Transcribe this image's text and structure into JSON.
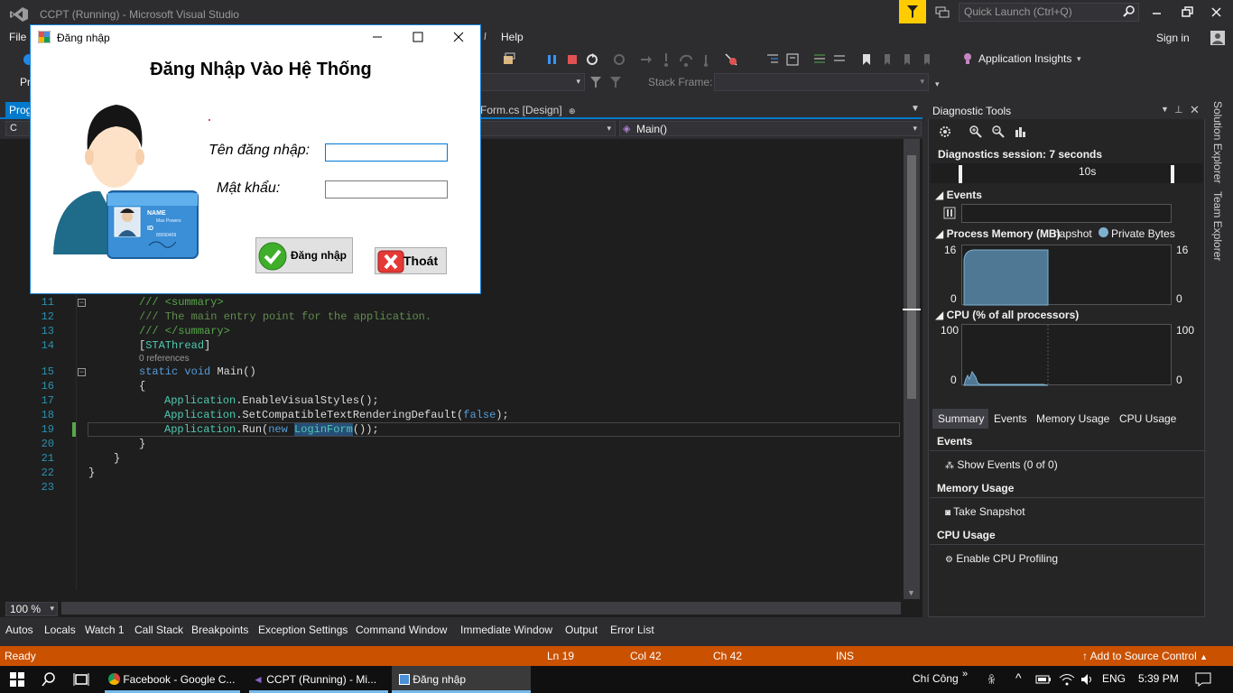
{
  "window": {
    "title": "CCPT (Running) - Microsoft Visual Studio",
    "quick_launch_placeholder": "Quick Launch (Ctrl+Q)",
    "sign_in": "Sign in"
  },
  "menu": [
    "File",
    "Help"
  ],
  "toolbar": {
    "app_insights": "Application Insights",
    "program_label": "Pr",
    "stack_frame_label": "Stack Frame:"
  },
  "tabs": {
    "program": "Prog",
    "design": "Form.cs [Design]"
  },
  "navbar": {
    "left": "C",
    "right": "Main()"
  },
  "editor": {
    "lines": [
      {
        "n": "11",
        "code": "/// <summary>",
        "type": "cm"
      },
      {
        "n": "12",
        "code": "/// The main entry point for the application.",
        "type": "cmg"
      },
      {
        "n": "13",
        "code": "/// </summary>",
        "type": "cm"
      },
      {
        "n": "14",
        "code": "[STAThread]",
        "type": "attr"
      },
      {
        "n": "15",
        "code": "static void Main()",
        "type": "decl"
      },
      {
        "n": "16",
        "code": "{",
        "type": "plain"
      },
      {
        "n": "17",
        "code": "Application.EnableVisualStyles();",
        "type": "call"
      },
      {
        "n": "18",
        "code": "Application.SetCompatibleTextRenderingDefault(false);",
        "type": "call"
      },
      {
        "n": "19",
        "code": "Application.Run(new LoginForm());",
        "type": "call"
      },
      {
        "n": "20",
        "code": "}",
        "type": "plain"
      },
      {
        "n": "21",
        "code": "}",
        "type": "plain"
      },
      {
        "n": "22",
        "code": "}",
        "type": "plain"
      },
      {
        "n": "23",
        "code": "",
        "type": "plain"
      }
    ],
    "references": "0 references",
    "zoom": "100 %"
  },
  "diagnostics": {
    "title": "Diagnostic Tools",
    "session": "Diagnostics session: 7 seconds",
    "timeline_tick": "10s",
    "events_header": "Events",
    "memory_header": "Process Memory (MB)",
    "memory_legend_snapshot": "napshot",
    "memory_legend_private": "Private Bytes",
    "memory_max": "16",
    "memory_min": "0",
    "cpu_header": "CPU (% of all processors)",
    "cpu_max": "100",
    "cpu_min": "0",
    "tabs": [
      "Summary",
      "Events",
      "Memory Usage",
      "CPU Usage"
    ],
    "summary": {
      "events_title": "Events",
      "events_link": "Show Events (0 of 0)",
      "memory_title": "Memory Usage",
      "memory_link": "Take Snapshot",
      "cpu_title": "CPU Usage",
      "cpu_link": "Enable CPU Profiling"
    }
  },
  "side_tabs": [
    "Solution Explorer",
    "Team Explorer"
  ],
  "bottom_tabs": [
    "Autos",
    "Locals",
    "Watch 1",
    "Call Stack",
    "Breakpoints",
    "Exception Settings",
    "Command Window",
    "Immediate Window",
    "Output",
    "Error List"
  ],
  "status": {
    "ready": "Ready",
    "ln": "Ln 19",
    "col": "Col 42",
    "ch": "Ch 42",
    "ins": "INS",
    "source_control": "Add to Source Control"
  },
  "taskbar": {
    "items": [
      "Facebook - Google C...",
      "CCPT (Running) - Mi...",
      "Đăng nhập"
    ],
    "user": "Chí Công",
    "lang": "ENG",
    "time": "5:39 PM"
  },
  "dialog": {
    "title": "Đăng nhập",
    "heading": "Đăng Nhập Vào Hệ Thống",
    "username_label": "Tên đăng nhập:",
    "password_label": "Mật khẩu:",
    "username_value": "",
    "password_value": "",
    "login_button": "Đăng nhập",
    "exit_button": "Thoát",
    "card_name": "NAME",
    "card_person": "Max Powers",
    "card_id": "ID",
    "card_number": "80090409"
  },
  "colors": {
    "accent": "#007acc",
    "status_bar": "#ca5100",
    "notification": "#ffcc00"
  }
}
